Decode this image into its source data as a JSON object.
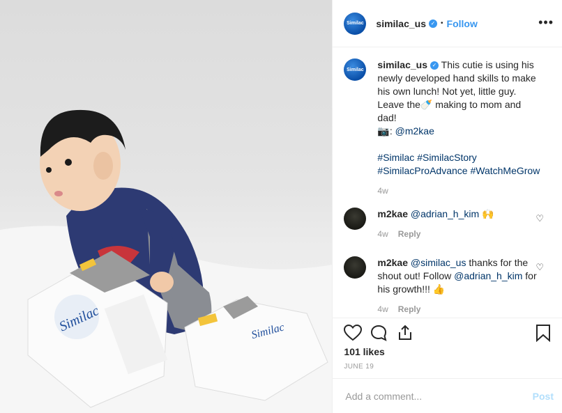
{
  "header": {
    "avatar_text": "Similac",
    "username": "similac_us",
    "separator": "•",
    "follow_label": "Follow",
    "more_label": "•••"
  },
  "caption": {
    "avatar_text": "Similac",
    "username": "similac_us",
    "text1": "This cutie is using his newly developed hand skills to make his own lunch! Not yet, little guy. Leave the",
    "bottle": "🍼",
    "text2": "making to mom and dad!",
    "camera": "📷",
    "colon": ":",
    "mention": "@m2kae",
    "hashtags1": "#Similac #SimilacStory",
    "hashtags2": "#SimilacProAdvance #WatchMeGrow",
    "time": "4w"
  },
  "comments": [
    {
      "username": "m2kae",
      "mention": "@adrian_h_kim",
      "text": "",
      "emoji": "🙌",
      "time": "4w",
      "reply": "Reply"
    },
    {
      "username": "m2kae",
      "mention": "@similac_us",
      "text": "thanks for the shout out! Follow",
      "mention2": "@adrian_h_kim",
      "text2": "for his growth!!!",
      "emoji": "👍",
      "time": "4w",
      "reply": "Reply"
    }
  ],
  "likes": "101 likes",
  "date": "JUNE 19",
  "add_comment": {
    "placeholder": "Add a comment...",
    "post_label": "Post"
  },
  "colors": {
    "accent": "#3897f0",
    "mention": "#003569",
    "brand": "#0a4fa8"
  }
}
